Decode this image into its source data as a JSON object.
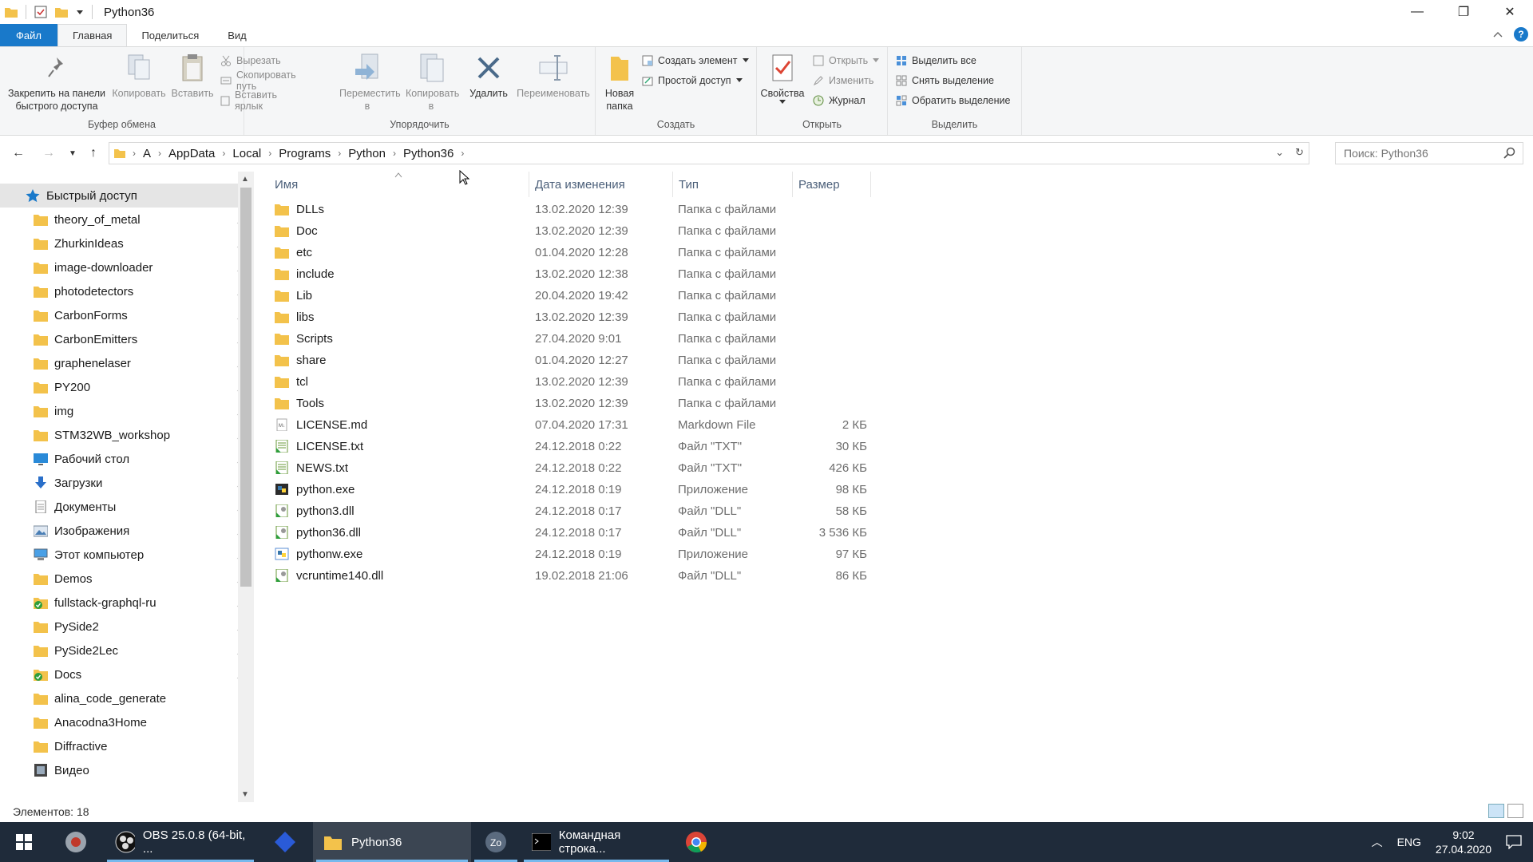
{
  "window": {
    "title": "Python36",
    "controls": {
      "minimize": "—",
      "restore": "❐",
      "close": "✕"
    }
  },
  "ribbon_tabs": [
    {
      "label": "Файл"
    },
    {
      "label": "Главная"
    },
    {
      "label": "Поделиться"
    },
    {
      "label": "Вид"
    }
  ],
  "ribbon": {
    "clipboard": {
      "label": "Буфер обмена",
      "pin": "Закрепить на панели быстрого доступа",
      "copy": "Копировать",
      "paste": "Вставить",
      "cut": "Вырезать",
      "copy_path": "Скопировать путь",
      "paste_shortcut": "Вставить ярлык"
    },
    "organize": {
      "label": "Упорядочить",
      "move": "Переместить в",
      "copyto": "Копировать в",
      "delete": "Удалить",
      "rename": "Переименовать"
    },
    "create": {
      "label": "Создать",
      "new_folder": "Новая папка",
      "new_item": "Создать элемент",
      "easy_access": "Простой доступ"
    },
    "open": {
      "label": "Открыть",
      "properties": "Свойства",
      "open": "Открыть",
      "edit": "Изменить",
      "history": "Журнал"
    },
    "select": {
      "label": "Выделить",
      "select_all": "Выделить все",
      "select_none": "Снять выделение",
      "invert": "Обратить выделение"
    }
  },
  "address": {
    "crumbs": [
      "A",
      "AppData",
      "Local",
      "Programs",
      "Python",
      "Python36"
    ],
    "search_placeholder": "Поиск: Python36"
  },
  "nav": [
    {
      "label": "Быстрый доступ",
      "icon": "star-icon",
      "pinned": false,
      "selected": true
    },
    {
      "label": "theory_of_metal",
      "icon": "folder-icon",
      "pinned": true
    },
    {
      "label": "ZhurkinIdeas",
      "icon": "folder-icon",
      "pinned": true
    },
    {
      "label": "image-downloader",
      "icon": "folder-icon",
      "pinned": true
    },
    {
      "label": "photodetectors",
      "icon": "folder-icon",
      "pinned": true
    },
    {
      "label": "CarbonForms",
      "icon": "folder-icon",
      "pinned": true
    },
    {
      "label": "CarbonEmitters",
      "icon": "folder-icon",
      "pinned": true
    },
    {
      "label": "graphenelaser",
      "icon": "folder-icon",
      "pinned": true
    },
    {
      "label": "PY200",
      "icon": "folder-icon",
      "pinned": true
    },
    {
      "label": "img",
      "icon": "folder-icon",
      "pinned": true
    },
    {
      "label": "STM32WB_workshop",
      "icon": "folder-icon",
      "pinned": true
    },
    {
      "label": "Рабочий стол",
      "icon": "desktop-icon",
      "pinned": true
    },
    {
      "label": "Загрузки",
      "icon": "download-icon",
      "pinned": true
    },
    {
      "label": "Документы",
      "icon": "documents-icon",
      "pinned": true
    },
    {
      "label": "Изображения",
      "icon": "pictures-icon",
      "pinned": true
    },
    {
      "label": "Этот компьютер",
      "icon": "computer-icon",
      "pinned": true
    },
    {
      "label": "Demos",
      "icon": "folder-icon",
      "pinned": true
    },
    {
      "label": "fullstack-graphql-ru",
      "icon": "green-check-folder-icon",
      "pinned": true
    },
    {
      "label": "PySide2",
      "icon": "folder-icon",
      "pinned": true
    },
    {
      "label": "PySide2Lec",
      "icon": "folder-icon",
      "pinned": true
    },
    {
      "label": "Docs",
      "icon": "green-check-folder-icon",
      "pinned": true
    },
    {
      "label": "alina_code_generate",
      "icon": "folder-icon",
      "pinned": false
    },
    {
      "label": "Anacodna3Home",
      "icon": "folder-icon",
      "pinned": false
    },
    {
      "label": "Diffractive",
      "icon": "folder-icon",
      "pinned": false
    },
    {
      "label": "Видео",
      "icon": "video-icon",
      "pinned": false
    }
  ],
  "columns": {
    "name": "Имя",
    "date": "Дата изменения",
    "type": "Тип",
    "size": "Размер"
  },
  "files": [
    {
      "name": "DLLs",
      "date": "13.02.2020 12:39",
      "type": "Папка с файлами",
      "size": "",
      "icon": "folder-icon"
    },
    {
      "name": "Doc",
      "date": "13.02.2020 12:39",
      "type": "Папка с файлами",
      "size": "",
      "icon": "folder-icon"
    },
    {
      "name": "etc",
      "date": "01.04.2020 12:28",
      "type": "Папка с файлами",
      "size": "",
      "icon": "folder-icon"
    },
    {
      "name": "include",
      "date": "13.02.2020 12:38",
      "type": "Папка с файлами",
      "size": "",
      "icon": "folder-icon"
    },
    {
      "name": "Lib",
      "date": "20.04.2020 19:42",
      "type": "Папка с файлами",
      "size": "",
      "icon": "folder-icon"
    },
    {
      "name": "libs",
      "date": "13.02.2020 12:39",
      "type": "Папка с файлами",
      "size": "",
      "icon": "folder-icon"
    },
    {
      "name": "Scripts",
      "date": "27.04.2020 9:01",
      "type": "Папка с файлами",
      "size": "",
      "icon": "folder-icon"
    },
    {
      "name": "share",
      "date": "01.04.2020 12:27",
      "type": "Папка с файлами",
      "size": "",
      "icon": "folder-icon"
    },
    {
      "name": "tcl",
      "date": "13.02.2020 12:39",
      "type": "Папка с файлами",
      "size": "",
      "icon": "folder-icon"
    },
    {
      "name": "Tools",
      "date": "13.02.2020 12:39",
      "type": "Папка с файлами",
      "size": "",
      "icon": "folder-icon"
    },
    {
      "name": "LICENSE.md",
      "date": "07.04.2020 17:31",
      "type": "Markdown File",
      "size": "2 КБ",
      "icon": "markdown-file-icon"
    },
    {
      "name": "LICENSE.txt",
      "date": "24.12.2018 0:22",
      "type": "Файл \"TXT\"",
      "size": "30 КБ",
      "icon": "text-file-icon"
    },
    {
      "name": "NEWS.txt",
      "date": "24.12.2018 0:22",
      "type": "Файл \"TXT\"",
      "size": "426 КБ",
      "icon": "text-file-icon"
    },
    {
      "name": "python.exe",
      "date": "24.12.2018 0:19",
      "type": "Приложение",
      "size": "98 КБ",
      "icon": "python-exe-icon"
    },
    {
      "name": "python3.dll",
      "date": "24.12.2018 0:17",
      "type": "Файл \"DLL\"",
      "size": "58 КБ",
      "icon": "dll-file-icon"
    },
    {
      "name": "python36.dll",
      "date": "24.12.2018 0:17",
      "type": "Файл \"DLL\"",
      "size": "3 536 КБ",
      "icon": "dll-file-icon"
    },
    {
      "name": "pythonw.exe",
      "date": "24.12.2018 0:19",
      "type": "Приложение",
      "size": "97 КБ",
      "icon": "pythonw-exe-icon"
    },
    {
      "name": "vcruntime140.dll",
      "date": "19.02.2018 21:06",
      "type": "Файл \"DLL\"",
      "size": "86 КБ",
      "icon": "dll-file-icon"
    }
  ],
  "status": {
    "count": "Элементов: 18"
  },
  "taskbar": {
    "items": [
      {
        "label": "",
        "icon": "start-icon"
      },
      {
        "label": "",
        "icon": "app-icon"
      },
      {
        "label": "OBS 25.0.8 (64-bit, ...",
        "icon": "obs-icon"
      },
      {
        "label": "",
        "icon": "diamond-app-icon"
      },
      {
        "label": "Python36",
        "icon": "explorer-folder-icon"
      },
      {
        "label": "",
        "icon": "zoom-icon"
      },
      {
        "label": "Командная строка...",
        "icon": "cmd-icon"
      },
      {
        "label": "",
        "icon": "chrome-icon"
      }
    ],
    "lang": "ENG",
    "time": "9:02",
    "date": "27.04.2020"
  },
  "colors": {
    "accent": "#1979ca",
    "taskbar": "#1f2b3a",
    "folder": "#f3c24b"
  }
}
